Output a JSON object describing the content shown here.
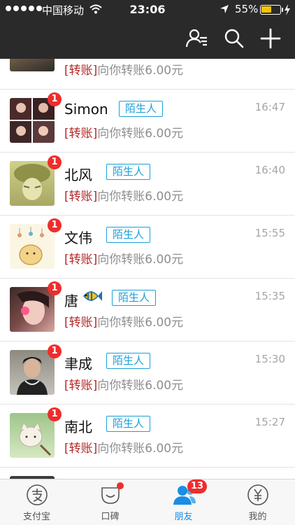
{
  "status_bar": {
    "carrier": "中国移动",
    "time": "23:06",
    "battery": "55%",
    "battery_level": 0.55
  },
  "header": {
    "icons": [
      "contacts-icon",
      "search-icon",
      "plus-icon"
    ]
  },
  "colors": {
    "header_bg": "#2a2a2a",
    "badge_red": "#f02c2c",
    "stranger_tag": "#1aa1d9",
    "transfer_keyword": "#b42a2a",
    "active_tab": "#1a8ee6"
  },
  "messages": [
    {
      "name": "",
      "tag": "",
      "time": "",
      "badge": "",
      "keyword": "[转账]",
      "text": "向你转账6.00元"
    },
    {
      "name": "Simon",
      "tag": "陌生人",
      "time": "16:47",
      "badge": "1",
      "keyword": "[转账]",
      "text": "向你转账6.00元"
    },
    {
      "name": "北风",
      "tag": "陌生人",
      "time": "16:40",
      "badge": "1",
      "keyword": "[转账]",
      "text": "向你转账6.00元"
    },
    {
      "name": "文伟",
      "tag": "陌生人",
      "time": "15:55",
      "badge": "1",
      "keyword": "[转账]",
      "text": "向你转账6.00元"
    },
    {
      "name": "唐",
      "tag": "陌生人",
      "time": "15:35",
      "badge": "1",
      "keyword": "[转账]",
      "text": "向你转账6.00元"
    },
    {
      "name": "聿成",
      "tag": "陌生人",
      "time": "15:30",
      "badge": "1",
      "keyword": "[转账]",
      "text": "向你转账6.00元"
    },
    {
      "name": "南北",
      "tag": "陌生人",
      "time": "15:27",
      "badge": "1",
      "keyword": "[转账]",
      "text": "向你转账6.00元"
    }
  ],
  "tabbar": {
    "tabs": [
      {
        "label": "支付宝",
        "icon": "alipay-icon"
      },
      {
        "label": "口碑",
        "icon": "koubei-icon"
      },
      {
        "label": "朋友",
        "icon": "friends-icon",
        "badge": "13",
        "active": true
      },
      {
        "label": "我的",
        "icon": "wallet-icon"
      }
    ]
  }
}
